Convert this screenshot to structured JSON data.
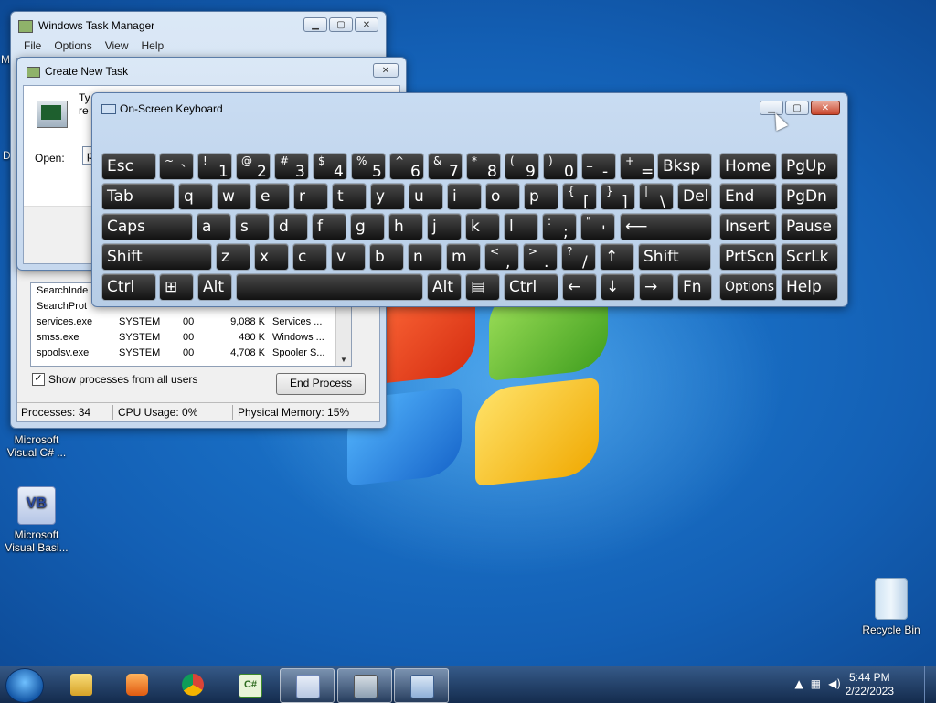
{
  "desktop": {
    "icons": [
      {
        "label": "Microsoft Visual C# ..."
      },
      {
        "label": "Microsoft Visual Basi..."
      },
      {
        "label": "Recycle Bin"
      }
    ],
    "vb_glyph": "VB",
    "edge_letters": [
      "M",
      "D"
    ]
  },
  "task_manager": {
    "title": "Windows Task Manager",
    "menu": [
      "File",
      "Options",
      "View",
      "Help"
    ],
    "processes": [
      {
        "name": "SearchInde",
        "user": "",
        "cpu": "",
        "mem": "",
        "desc": ""
      },
      {
        "name": "SearchProt",
        "user": "",
        "cpu": "",
        "mem": "",
        "desc": ""
      },
      {
        "name": "services.exe",
        "user": "SYSTEM",
        "cpu": "00",
        "mem": "9,088 K",
        "desc": "Services ..."
      },
      {
        "name": "smss.exe",
        "user": "SYSTEM",
        "cpu": "00",
        "mem": "480 K",
        "desc": "Windows ..."
      },
      {
        "name": "spoolsv.exe",
        "user": "SYSTEM",
        "cpu": "00",
        "mem": "4,708 K",
        "desc": "Spooler S..."
      }
    ],
    "show_all_label": "Show processes from all users",
    "show_all_checked": true,
    "end_process_label": "End Process",
    "status": {
      "processes": "Processes: 34",
      "cpu": "CPU Usage: 0%",
      "memory": "Physical Memory: 15%"
    }
  },
  "create_task": {
    "title": "Create New Task",
    "description_partial": [
      "Ty",
      "re"
    ],
    "open_label": "Open:",
    "open_value": "p"
  },
  "osk": {
    "title": "On-Screen Keyboard",
    "rows": [
      [
        {
          "label": "Esc"
        },
        {
          "top": "~",
          "bot": "`"
        },
        {
          "top": "!",
          "bot": "1"
        },
        {
          "top": "@",
          "bot": "2"
        },
        {
          "top": "#",
          "bot": "3"
        },
        {
          "top": "$",
          "bot": "4"
        },
        {
          "top": "%",
          "bot": "5"
        },
        {
          "top": "^",
          "bot": "6"
        },
        {
          "top": "&",
          "bot": "7"
        },
        {
          "top": "*",
          "bot": "8"
        },
        {
          "top": "(",
          "bot": "9"
        },
        {
          "top": ")",
          "bot": "0"
        },
        {
          "top": "_",
          "bot": "-"
        },
        {
          "top": "+",
          "bot": "="
        },
        {
          "label": "Bksp"
        },
        {
          "label": "Home"
        },
        {
          "label": "PgUp"
        }
      ],
      [
        {
          "label": "Tab"
        },
        {
          "label": "q"
        },
        {
          "label": "w"
        },
        {
          "label": "e"
        },
        {
          "label": "r"
        },
        {
          "label": "t"
        },
        {
          "label": "y"
        },
        {
          "label": "u"
        },
        {
          "label": "i"
        },
        {
          "label": "o"
        },
        {
          "label": "p"
        },
        {
          "top": "{",
          "bot": "["
        },
        {
          "top": "}",
          "bot": "]"
        },
        {
          "top": "|",
          "bot": "\\"
        },
        {
          "label": "Del"
        },
        {
          "label": "End"
        },
        {
          "label": "PgDn"
        }
      ],
      [
        {
          "label": "Caps"
        },
        {
          "label": "a"
        },
        {
          "label": "s"
        },
        {
          "label": "d"
        },
        {
          "label": "f"
        },
        {
          "label": "g"
        },
        {
          "label": "h"
        },
        {
          "label": "j"
        },
        {
          "label": "k"
        },
        {
          "label": "l"
        },
        {
          "top": ":",
          "bot": ";"
        },
        {
          "top": "\"",
          "bot": "'"
        },
        {
          "label": "⟵"
        },
        {
          "label": "Insert"
        },
        {
          "label": "Pause"
        }
      ],
      [
        {
          "label": "Shift"
        },
        {
          "label": "z"
        },
        {
          "label": "x"
        },
        {
          "label": "c"
        },
        {
          "label": "v"
        },
        {
          "label": "b"
        },
        {
          "label": "n"
        },
        {
          "label": "m"
        },
        {
          "top": "<",
          "bot": ","
        },
        {
          "top": ">",
          "bot": "."
        },
        {
          "top": "?",
          "bot": "/"
        },
        {
          "label": "↑"
        },
        {
          "label": "Shift"
        },
        {
          "label": "PrtScn"
        },
        {
          "label": "ScrLk"
        }
      ],
      [
        {
          "label": "Ctrl"
        },
        {
          "label": "⊞"
        },
        {
          "label": "Alt"
        },
        {
          "label": ""
        },
        {
          "label": "Alt"
        },
        {
          "label": "▤"
        },
        {
          "label": "Ctrl"
        },
        {
          "label": "←"
        },
        {
          "label": "↓"
        },
        {
          "label": "→"
        },
        {
          "label": "Fn"
        },
        {
          "label": "Options"
        },
        {
          "label": "Help"
        }
      ]
    ]
  },
  "taskbar": {
    "clock_time": "5:44 PM",
    "clock_date": "2/22/2023",
    "tray_chevron": "▲",
    "csharp_glyph": "C#"
  },
  "window_controls": {
    "minimize": "▁",
    "maximize": "▢",
    "close": "✕"
  },
  "colors": {
    "desktop_blue": "#135fb4",
    "key_bg": "#1e1e1e",
    "close_red": "#c9452c"
  }
}
